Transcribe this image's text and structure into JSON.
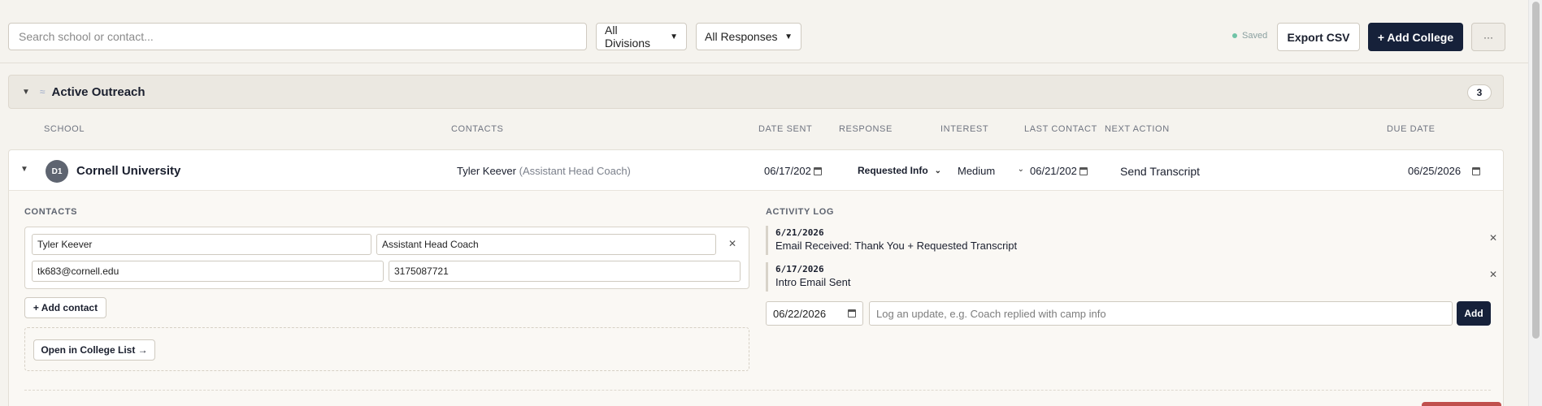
{
  "toolbar": {
    "search_placeholder": "Search school or contact...",
    "division_select": "All Divisions",
    "response_select": "All Responses",
    "saved_label": "Saved",
    "export_label": "Export CSV",
    "add_college_label": "+ Add College",
    "more_label": "···"
  },
  "group": {
    "title": "Active Outreach",
    "count": "3",
    "icon": "wave-icon"
  },
  "columns": {
    "school": "SCHOOL",
    "contacts": "CONTACTS",
    "date_sent": "DATE SENT",
    "response": "RESPONSE",
    "interest": "INTEREST",
    "last_contact": "LAST CONTACT",
    "next_action": "NEXT ACTION",
    "due_date": "DUE DATE"
  },
  "row": {
    "division_badge": "D1",
    "school": "Cornell University",
    "contact_name": "Tyler Keever",
    "contact_role": "(Assistant Head Coach)",
    "date_sent": "06/17/202",
    "response": "Requested Info",
    "interest": "Medium",
    "last_contact": "06/21/202",
    "next_action": "Send Transcript",
    "due_date": "06/25/2026"
  },
  "details": {
    "contacts_title": "CONTACTS",
    "contact": {
      "name": "Tyler Keever",
      "role": "Assistant Head Coach",
      "email": "tk683@cornell.edu",
      "phone": "3175087721"
    },
    "add_contact_label": "+ Add contact",
    "open_list_label": "Open in College List →",
    "activity_title": "ACTIVITY LOG",
    "log": [
      {
        "date": "6/21/2026",
        "text": "Email Received: Thank You + Requested Transcript"
      },
      {
        "date": "6/17/2026",
        "text": "Intro Email Sent"
      }
    ],
    "new_log_date": "06/22/2026",
    "new_log_placeholder": "Log an update, e.g. Coach replied with camp info",
    "add_log_label": "Add"
  },
  "colors": {
    "primary": "#16213a",
    "background": "#f5f3ee",
    "saved_dot": "#6fc3a6",
    "danger": "#c0504d"
  }
}
